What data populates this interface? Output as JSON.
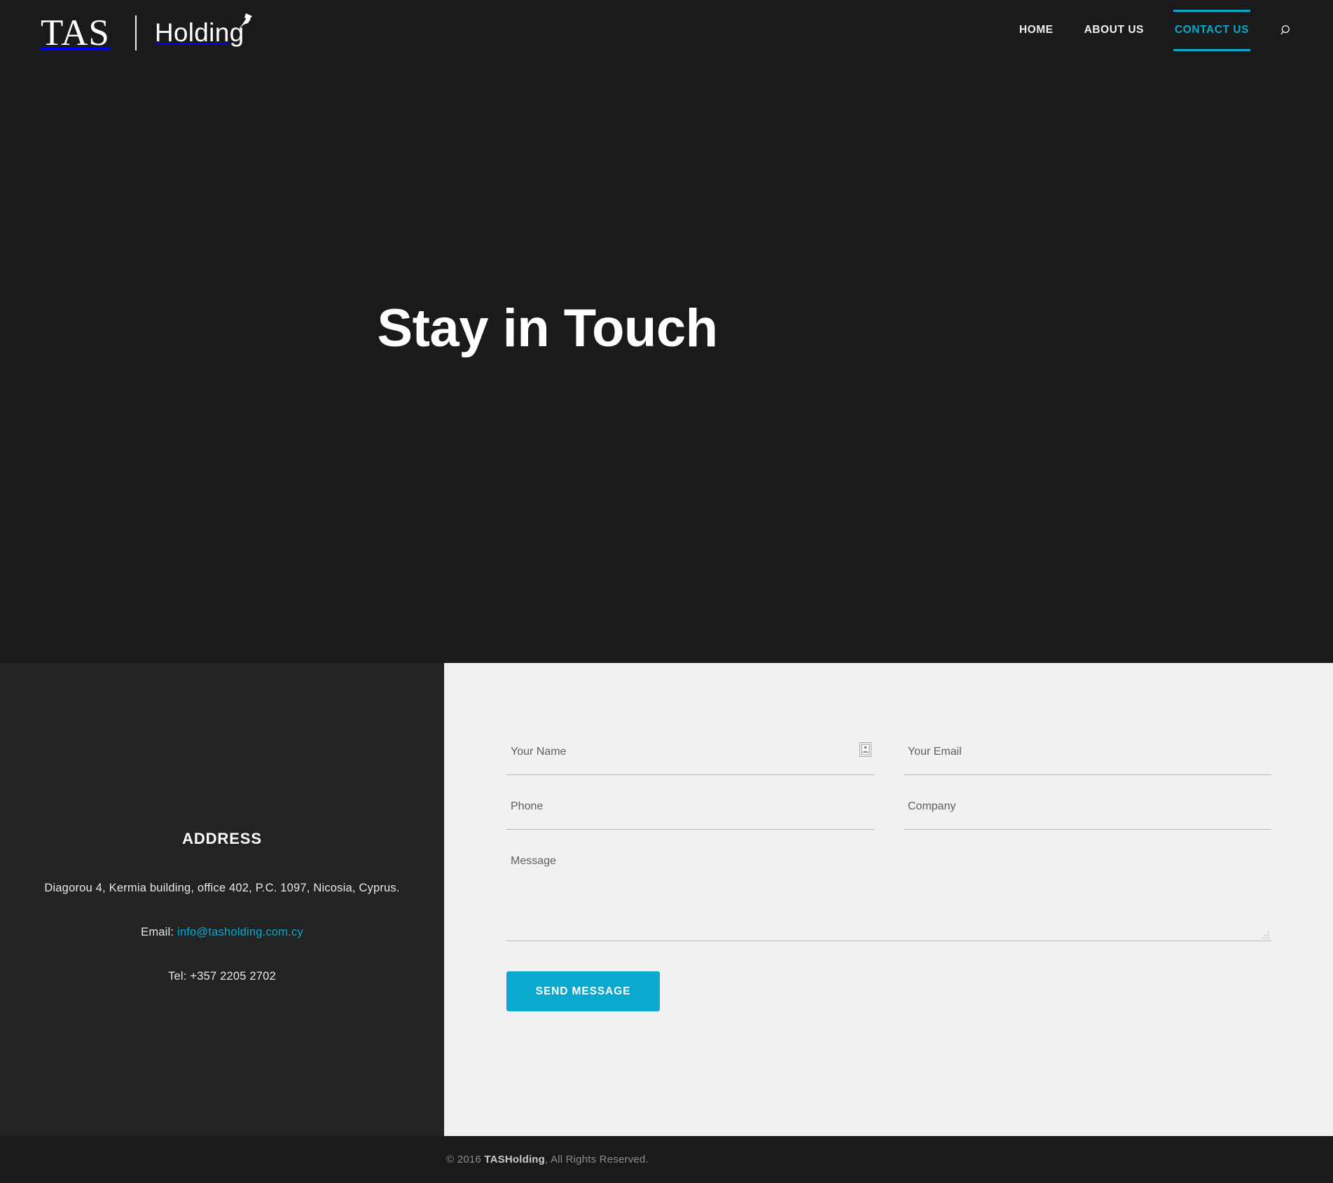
{
  "site": {
    "logo": {
      "primary": "TAS",
      "secondary": "Holding",
      "mark_icon": "bird-swoosh-icon"
    },
    "accent_color": "#0aa8cf",
    "hero_bg": "#1a1a1a",
    "panel_bg": "#232323",
    "form_bg": "#f1f1f1"
  },
  "nav": {
    "items": [
      {
        "label": "HOME",
        "active": false
      },
      {
        "label": "ABOUT US",
        "active": false
      },
      {
        "label": "CONTACT US",
        "active": true
      }
    ],
    "search_icon": "search-icon"
  },
  "hero": {
    "title": "Stay in Touch"
  },
  "address": {
    "heading": "ADDRESS",
    "street": "Diagorou 4, Kermia building, office 402, P.C. 1097, Nicosia, Cyprus.",
    "email_label": "Email:",
    "email": "info@tasholding.com.cy",
    "tel": "Tel: +357 2205 2702"
  },
  "form": {
    "fields": {
      "name": {
        "placeholder": "Your Name",
        "value": "",
        "autofill_icon": "contact-card-icon"
      },
      "email": {
        "placeholder": "Your Email",
        "value": ""
      },
      "phone": {
        "placeholder": "Phone",
        "value": ""
      },
      "company": {
        "placeholder": "Company",
        "value": ""
      },
      "message": {
        "placeholder": "Message",
        "value": ""
      }
    },
    "submit_label": "SEND MESSAGE"
  },
  "footer": {
    "copyright_prefix": "© 2016 ",
    "brand": "TASHolding",
    "copyright_suffix": ", All Rights Reserved."
  }
}
